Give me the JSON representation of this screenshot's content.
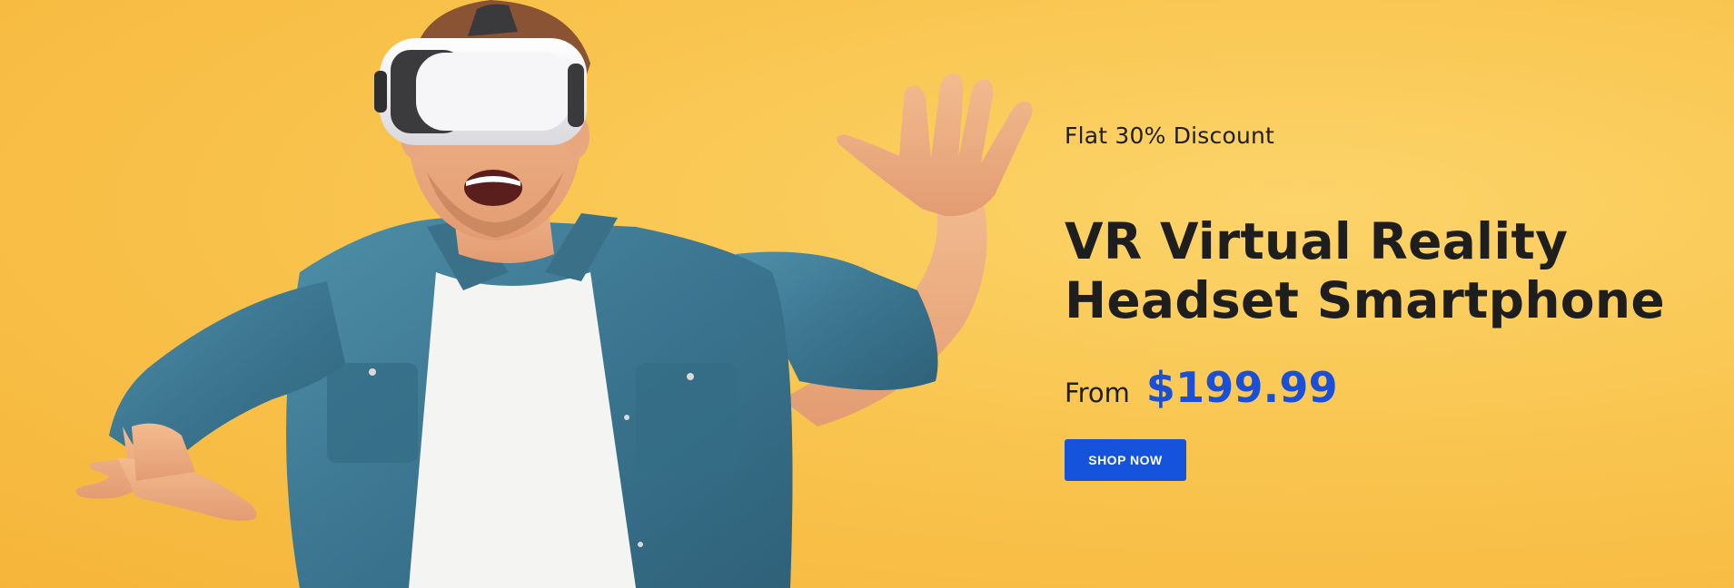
{
  "hero": {
    "kicker": "Flat 30% Discount",
    "title_line_1": "VR Virtual Reality",
    "title_line_2": "Headset Smartphone",
    "price_prefix": "From",
    "price": "$199.99",
    "cta_label": "SHOP NOW"
  },
  "colors": {
    "background": "#f9c54f",
    "price_accent": "#1a4fd6",
    "button": "#1553dd",
    "text": "#1e1e1e"
  },
  "image": {
    "subject": "man-wearing-vr-headset"
  }
}
